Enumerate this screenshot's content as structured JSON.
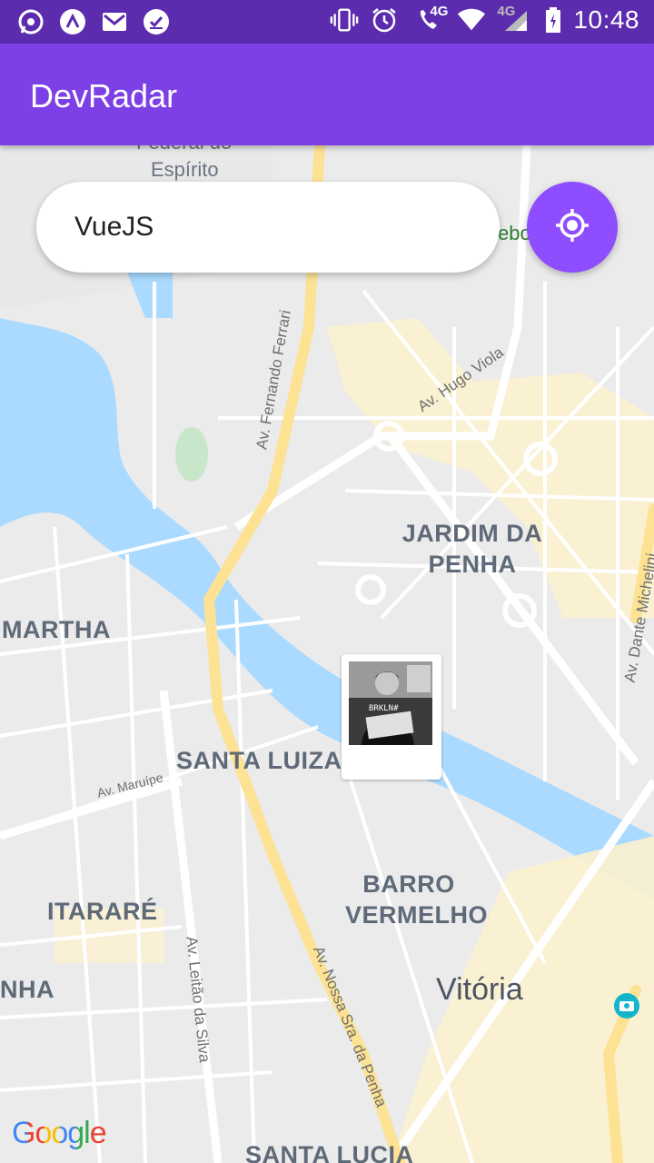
{
  "status_bar": {
    "time": "10:48",
    "network_1": "4G",
    "network_2": "4G",
    "left_icons": [
      "whatsapp-icon",
      "arch-icon",
      "gmail-icon",
      "task-icon"
    ],
    "right_icons": [
      "vibrate-icon",
      "alarm-icon",
      "volte-call-icon",
      "wifi-icon",
      "signal-icon",
      "battery-icon"
    ]
  },
  "app_bar": {
    "title": "DevRadar"
  },
  "search": {
    "value": "VueJS"
  },
  "locate_button": {
    "icon": "gps-fixed-icon"
  },
  "marker": {
    "icon": "developer-avatar"
  },
  "map": {
    "labels": {
      "federal": "Federal do",
      "espirito": "Espírito",
      "ebo": "ebo",
      "fernando_ferrari": "Av. Fernando Ferrari",
      "hugo_viola": "Av. Hugo Viola",
      "jardim_penha": "JARDIM DA PENHA",
      "martha": "MARTHA",
      "dante_michelini": "Av. Dante Michelini",
      "santa_luiza": "SANTA LUIZA",
      "maruipe": "Av. Maruípe",
      "barro_vermelho": "BARRO VERMELHO",
      "itarare": "ITARARÉ",
      "leitao_silva": "Av. Leitão da Silva",
      "nossa_sra_penha": "Av. Nossa Sra. da Penha",
      "nha": "NHA",
      "vitoria": "Vitória",
      "santa_lucia": "SANTA LUCIA"
    },
    "attribution": "Google"
  },
  "colors": {
    "status_bar": "#5c2cae",
    "app_bar": "#7d40e7",
    "accent": "#8e4dff",
    "water": "#aadaff",
    "land": "#e5e3df",
    "highway": "#fde293"
  }
}
